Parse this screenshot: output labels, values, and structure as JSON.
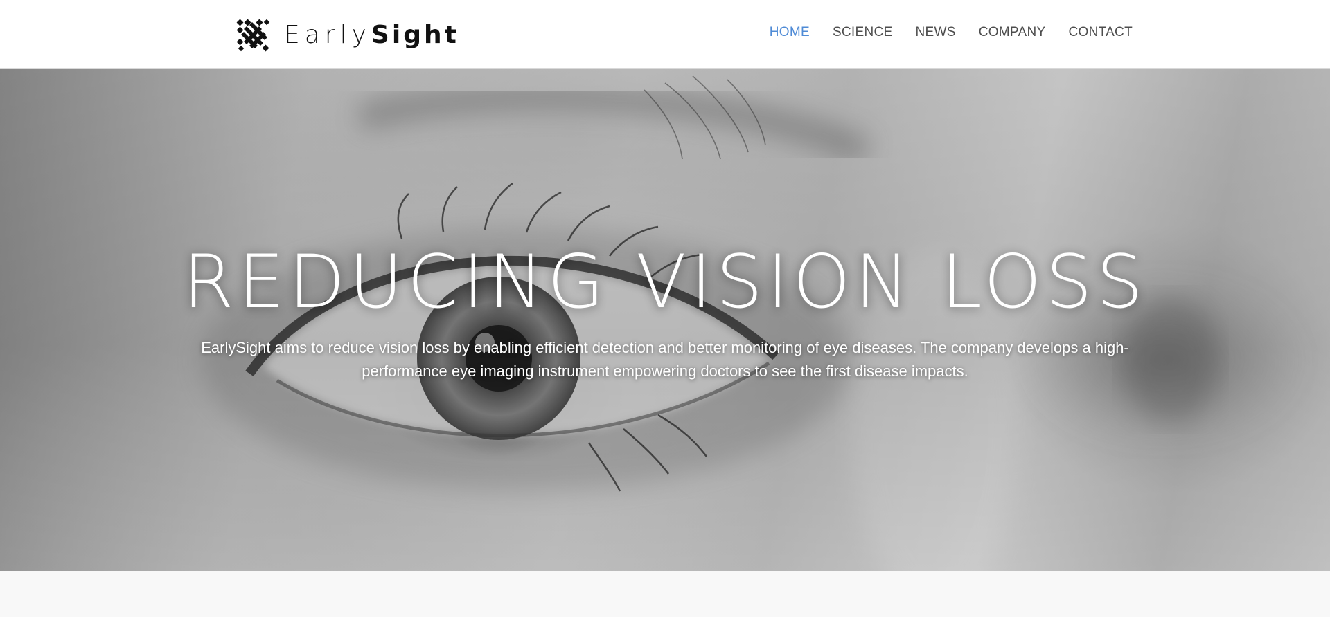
{
  "brand": {
    "name_light": "Early",
    "name_bold": "Sight",
    "logo_icon": "earlysight-logo-mark"
  },
  "nav": {
    "items": [
      {
        "label": "HOME",
        "active": true
      },
      {
        "label": "SCIENCE",
        "active": false
      },
      {
        "label": "NEWS",
        "active": false
      },
      {
        "label": "COMPANY",
        "active": false
      },
      {
        "label": "CONTACT",
        "active": false
      }
    ],
    "active_color": "#4f8bd6",
    "text_color": "#4d4d4d"
  },
  "hero": {
    "title": "REDUCING VISION LOSS",
    "text": "EarlySight aims to reduce vision loss by enabling efficient detection and better monitoring of eye diseases. The company develops a high-performance eye imaging instrument empowering doctors to see the first disease impacts."
  }
}
